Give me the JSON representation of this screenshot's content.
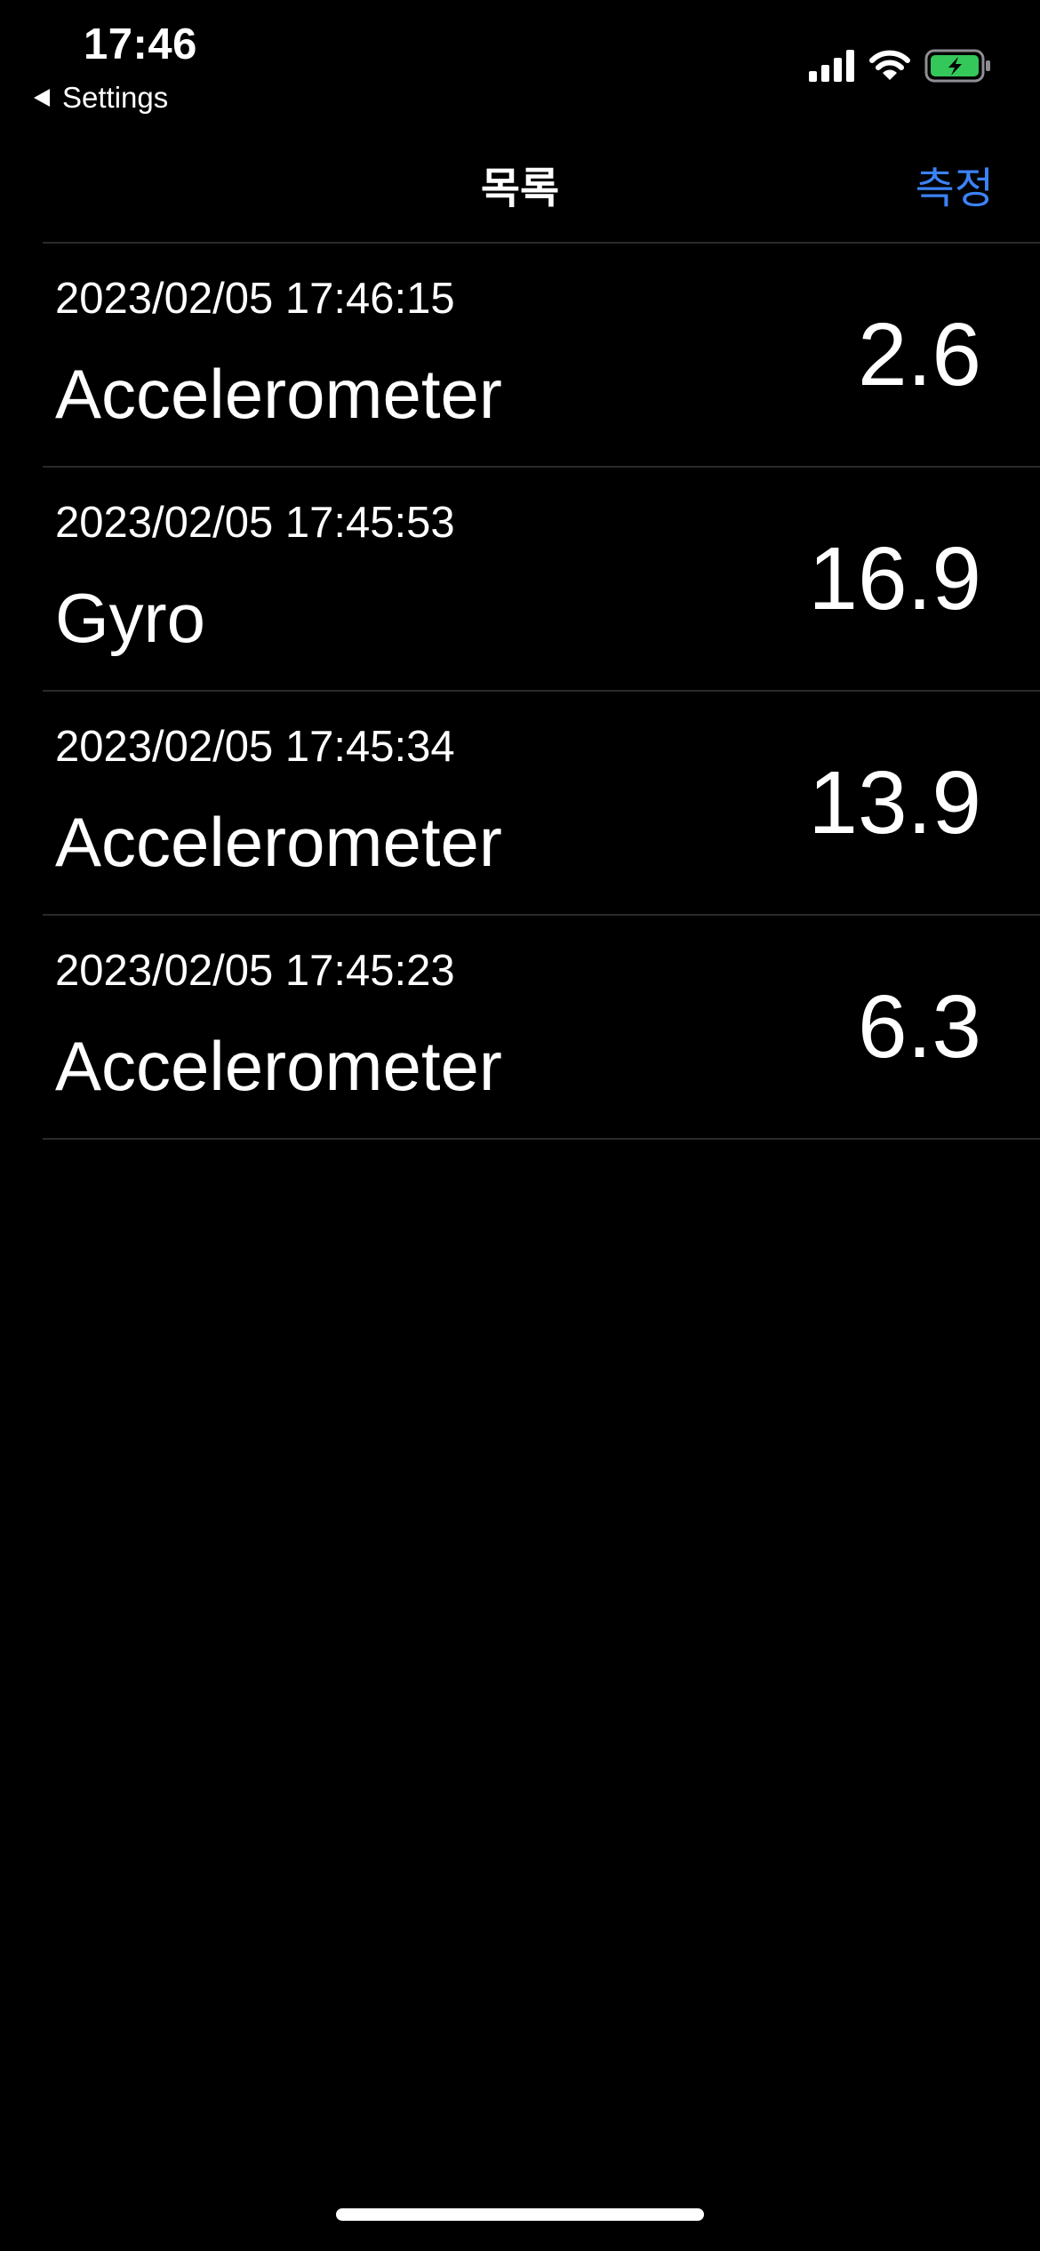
{
  "status_bar": {
    "time": "17:46",
    "back_label": "Settings"
  },
  "nav": {
    "title": "목록",
    "action_label": "측정",
    "action_color": "#3b82f6"
  },
  "records": [
    {
      "datetime": "2023/02/05 17:46:15",
      "sensor": "Accelerometer",
      "value": "2.6"
    },
    {
      "datetime": "2023/02/05 17:45:53",
      "sensor": "Gyro",
      "value": "16.9"
    },
    {
      "datetime": "2023/02/05 17:45:34",
      "sensor": "Accelerometer",
      "value": "13.9"
    },
    {
      "datetime": "2023/02/05 17:45:23",
      "sensor": "Accelerometer",
      "value": "6.3"
    }
  ],
  "icons": {
    "signal": "cellular-signal-icon",
    "wifi": "wifi-icon",
    "battery": "battery-charging-icon",
    "battery_color": "#34c759"
  }
}
